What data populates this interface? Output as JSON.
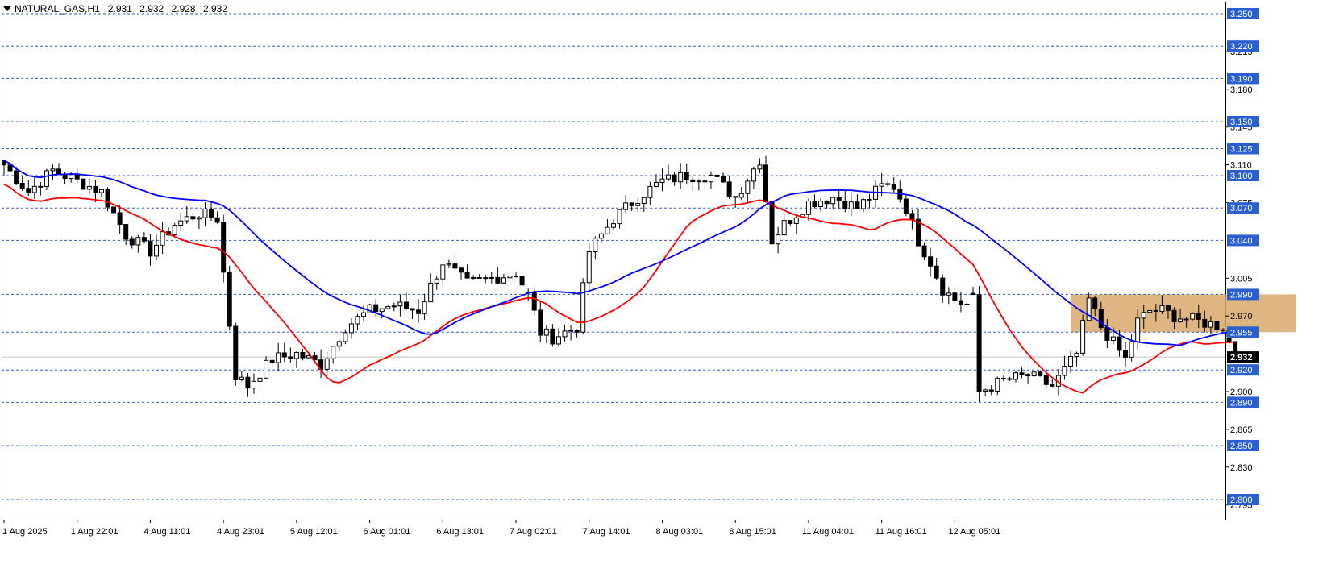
{
  "header": {
    "symbol": "NATURAL_GAS,H1",
    "open": "2.931",
    "high": "2.932",
    "low": "2.928",
    "close": "2.932"
  },
  "colors": {
    "background": "#ffffff",
    "level_line": "#2a5fcf",
    "level_label_bg": "#2a5fcf",
    "price_label_bg": "#000000",
    "ma_fast": "#ff0000",
    "ma_slow": "#0000ff",
    "zone_fill": "#d9a86c",
    "candle_bull": "#ffffff",
    "candle_bear": "#000000",
    "axis_text": "#000000"
  },
  "chart_data": {
    "type": "candlestick",
    "y_axis": {
      "range": [
        2.78,
        3.26
      ],
      "tick_labels": [
        "3.215",
        "3.180",
        "3.145",
        "3.110",
        "3.075",
        "3.005",
        "2.970",
        "2.900",
        "2.865",
        "2.830",
        "2.795"
      ]
    },
    "levels": [
      "3.250",
      "3.220",
      "3.190",
      "3.150",
      "3.125",
      "3.100",
      "3.070",
      "3.040",
      "2.990",
      "2.955",
      "2.920",
      "2.890",
      "2.850",
      "2.800"
    ],
    "current_price": "2.932",
    "x_axis": {
      "tick_labels": [
        "1 Aug 2025",
        "1 Aug 22:01",
        "4 Aug 11:01",
        "4 Aug 23:01",
        "5 Aug 12:01",
        "6 Aug 01:01",
        "6 Aug 13:01",
        "7 Aug 02:01",
        "7 Aug 14:01",
        "8 Aug 03:01",
        "8 Aug 15:01",
        "11 Aug 04:01",
        "11 Aug 16:01",
        "12 Aug 05:01"
      ],
      "bars_per_tick": 12
    },
    "anchors": [
      [
        0,
        3.11
      ],
      [
        4,
        3.085
      ],
      [
        8,
        3.105
      ],
      [
        12,
        3.095
      ],
      [
        16,
        3.085
      ],
      [
        20,
        3.045
      ],
      [
        24,
        3.03
      ],
      [
        28,
        3.055
      ],
      [
        32,
        3.065
      ],
      [
        35,
        3.06
      ],
      [
        36,
        3.01
      ],
      [
        38,
        2.915
      ],
      [
        40,
        2.905
      ],
      [
        44,
        2.93
      ],
      [
        48,
        2.935
      ],
      [
        52,
        2.925
      ],
      [
        56,
        2.96
      ],
      [
        60,
        2.975
      ],
      [
        64,
        2.98
      ],
      [
        68,
        2.975
      ],
      [
        72,
        3.02
      ],
      [
        76,
        3.0
      ],
      [
        80,
        3.005
      ],
      [
        84,
        3.01
      ],
      [
        86,
        2.99
      ],
      [
        88,
        2.955
      ],
      [
        90,
        2.95
      ],
      [
        94,
        2.96
      ],
      [
        96,
        3.03
      ],
      [
        100,
        3.06
      ],
      [
        104,
        3.08
      ],
      [
        108,
        3.095
      ],
      [
        112,
        3.1
      ],
      [
        116,
        3.1
      ],
      [
        120,
        3.08
      ],
      [
        124,
        3.115
      ],
      [
        126,
        3.04
      ],
      [
        128,
        3.055
      ],
      [
        132,
        3.075
      ],
      [
        136,
        3.08
      ],
      [
        140,
        3.07
      ],
      [
        144,
        3.09
      ],
      [
        146,
        3.09
      ],
      [
        148,
        3.07
      ],
      [
        150,
        3.04
      ],
      [
        152,
        3.02
      ],
      [
        154,
        2.995
      ],
      [
        156,
        2.985
      ],
      [
        158,
        2.98
      ],
      [
        159,
        2.985
      ],
      [
        160,
        2.9
      ],
      [
        164,
        2.91
      ],
      [
        168,
        2.915
      ],
      [
        172,
        2.905
      ],
      [
        176,
        2.935
      ],
      [
        178,
        2.985
      ],
      [
        180,
        2.96
      ],
      [
        182,
        2.945
      ],
      [
        184,
        2.93
      ],
      [
        186,
        2.965
      ],
      [
        188,
        2.975
      ],
      [
        190,
        2.975
      ],
      [
        192,
        2.97
      ],
      [
        196,
        2.965
      ],
      [
        200,
        2.96
      ],
      [
        202,
        2.932
      ]
    ],
    "gaps": [
      159,
      86
    ],
    "ma_fast_period": 18,
    "ma_slow_period": 34,
    "zone": {
      "bars": [
        175,
        212
      ],
      "price_range": [
        2.955,
        2.99
      ]
    }
  }
}
